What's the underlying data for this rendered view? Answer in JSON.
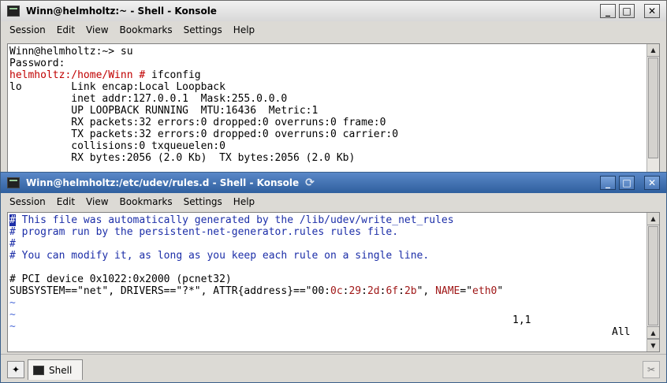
{
  "window_a": {
    "title": "Winn@helmholtz:~ - Shell - Konsole",
    "menu": [
      "Session",
      "Edit",
      "View",
      "Bookmarks",
      "Settings",
      "Help"
    ],
    "terminal_lines": [
      {
        "parts": [
          {
            "t": "Winn@helmholtz:~> su",
            "c": ""
          }
        ]
      },
      {
        "parts": [
          {
            "t": "Password:",
            "c": ""
          }
        ]
      },
      {
        "parts": [
          {
            "t": "helmholtz:/home/Winn # ",
            "c": "red"
          },
          {
            "t": "ifconfig",
            "c": ""
          }
        ]
      },
      {
        "parts": [
          {
            "t": "lo        Link encap:Local Loopback",
            "c": ""
          }
        ]
      },
      {
        "parts": [
          {
            "t": "          inet addr:127.0.0.1  Mask:255.0.0.0",
            "c": ""
          }
        ]
      },
      {
        "parts": [
          {
            "t": "          UP LOOPBACK RUNNING  MTU:16436  Metric:1",
            "c": ""
          }
        ]
      },
      {
        "parts": [
          {
            "t": "          RX packets:32 errors:0 dropped:0 overruns:0 frame:0",
            "c": ""
          }
        ]
      },
      {
        "parts": [
          {
            "t": "          TX packets:32 errors:0 dropped:0 overruns:0 carrier:0",
            "c": ""
          }
        ]
      },
      {
        "parts": [
          {
            "t": "          collisions:0 txqueuelen:0",
            "c": ""
          }
        ]
      },
      {
        "parts": [
          {
            "t": "          RX bytes:2056 (2.0 Kb)  TX bytes:2056 (2.0 Kb)",
            "c": ""
          }
        ]
      }
    ]
  },
  "window_b": {
    "title": "Winn@helmholtz:/etc/udev/rules.d - Shell - Konsole",
    "menu": [
      "Session",
      "Edit",
      "View",
      "Bookmarks",
      "Settings",
      "Help"
    ],
    "terminal_lines": [
      {
        "parts": [
          {
            "t": "#",
            "c": "cursor"
          },
          {
            "t": " This file was automatically generated by the /lib/udev/write_net_rules",
            "c": "blue"
          }
        ]
      },
      {
        "parts": [
          {
            "t": "# program run by the persistent-net-generator.rules rules file.",
            "c": "blue"
          }
        ]
      },
      {
        "parts": [
          {
            "t": "#",
            "c": "blue"
          }
        ]
      },
      {
        "parts": [
          {
            "t": "# You can modify it, as long as you keep each rule on a single line.",
            "c": "blue"
          }
        ]
      },
      {
        "parts": [
          {
            "t": "",
            "c": ""
          }
        ]
      },
      {
        "parts": [
          {
            "t": "# PCI device 0x1022:0x2000 (pcnet32)",
            "c": ""
          }
        ]
      },
      {
        "parts": [
          {
            "t": "SUBSYSTEM==\"net\", DRIVERS==\"?*\", ATTR{address}==\"00:",
            "c": ""
          },
          {
            "t": "0c",
            "c": "dred"
          },
          {
            "t": ":",
            "c": ""
          },
          {
            "t": "29",
            "c": "dred"
          },
          {
            "t": ":",
            "c": ""
          },
          {
            "t": "2d",
            "c": "dred"
          },
          {
            "t": ":",
            "c": ""
          },
          {
            "t": "6f",
            "c": "dred"
          },
          {
            "t": ":",
            "c": ""
          },
          {
            "t": "2b",
            "c": "dred"
          },
          {
            "t": "\", ",
            "c": ""
          },
          {
            "t": "NAME",
            "c": "dred"
          },
          {
            "t": "=\"",
            "c": ""
          },
          {
            "t": "eth0",
            "c": "dred"
          },
          {
            "t": "\"",
            "c": ""
          }
        ]
      },
      {
        "parts": [
          {
            "t": "~",
            "c": "tilde"
          }
        ]
      },
      {
        "parts": [
          {
            "t": "~",
            "c": "tilde"
          }
        ]
      },
      {
        "parts": [
          {
            "t": "~",
            "c": "tilde"
          }
        ]
      }
    ],
    "status_position": "1,1",
    "status_scope": "All",
    "tab_label": "Shell"
  }
}
